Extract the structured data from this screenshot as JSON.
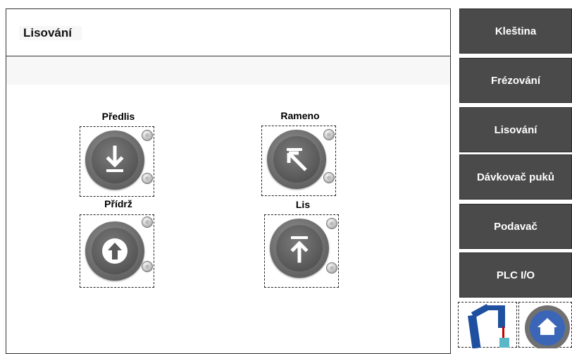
{
  "header": {
    "title": "Lisování"
  },
  "controls": [
    {
      "label": "Předlis",
      "icon": "arrow-down-bar-icon"
    },
    {
      "label": "Rameno",
      "icon": "arrow-up-left-icon"
    },
    {
      "label": "Přídrž",
      "icon": "arrow-up-circle-icon"
    },
    {
      "label": "Lis",
      "icon": "arrow-up-bar-icon"
    }
  ],
  "sidebar": {
    "items": [
      {
        "label": "Kleština"
      },
      {
        "label": "Frézování"
      },
      {
        "label": "Lisování"
      },
      {
        "label": "Dávkovač puků"
      },
      {
        "label": "Podavač"
      },
      {
        "label": "PLC I/O"
      }
    ]
  },
  "bottom_icons": [
    "robot-arm-icon",
    "home-icon"
  ],
  "colors": {
    "nav_bg": "#4a4a4a",
    "home_blue": "#3b66b8"
  }
}
